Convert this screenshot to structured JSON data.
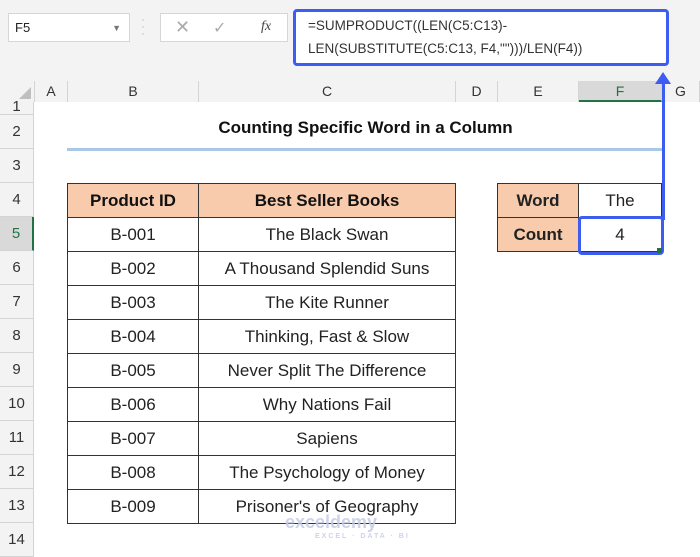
{
  "formula_bar": {
    "name_box": "F5",
    "cancel_icon": "✕",
    "enter_icon": "✓",
    "fx_label": "fx",
    "formula_line1": "=SUMPRODUCT((LEN(C5:C13)-",
    "formula_line2": "LEN(SUBSTITUTE(C5:C13, F4,\"\")))/LEN(F4))"
  },
  "columns": [
    "A",
    "B",
    "C",
    "D",
    "E",
    "F",
    "G"
  ],
  "selected_column": "F",
  "rows": [
    "1",
    "2",
    "3",
    "4",
    "5",
    "6",
    "7",
    "8",
    "9",
    "10",
    "11",
    "12",
    "13",
    "14"
  ],
  "selected_row": "5",
  "sheet": {
    "title": "Counting Specific Word in a Column",
    "table": {
      "headers": [
        "Product ID",
        "Best Seller Books"
      ],
      "rows": [
        [
          "B-001",
          "The Black Swan"
        ],
        [
          "B-002",
          "A Thousand Splendid Suns"
        ],
        [
          "B-003",
          "The Kite Runner"
        ],
        [
          "B-004",
          "Thinking, Fast & Slow"
        ],
        [
          "B-005",
          "Never Split The Difference"
        ],
        [
          "B-006",
          "Why Nations Fail"
        ],
        [
          "B-007",
          "Sapiens"
        ],
        [
          "B-008",
          "The Psychology of Money"
        ],
        [
          "B-009",
          "Prisoner's of Geography"
        ]
      ]
    },
    "word_label": "Word",
    "word_value": "The",
    "count_label": "Count",
    "count_value": "4"
  },
  "watermark": {
    "brand": "exceldemy",
    "tagline": "EXCEL · DATA · BI"
  },
  "colors": {
    "accent": "#3d5cf0",
    "header_fill": "#f8cbad",
    "excel_green": "#217346"
  }
}
